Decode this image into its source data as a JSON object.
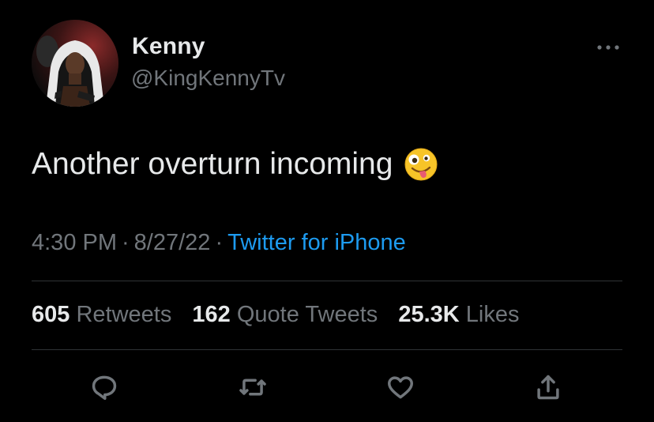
{
  "author": {
    "display_name": "Kenny",
    "handle": "@KingKennyTv"
  },
  "tweet": {
    "text": "Another overturn incoming",
    "emoji_icon": "zany-face-icon"
  },
  "meta": {
    "time": "4:30 PM",
    "separator": "·",
    "date": "8/27/22",
    "source": "Twitter for iPhone"
  },
  "stats": {
    "retweets_count": "605",
    "retweets_label": "Retweets",
    "quotes_count": "162",
    "quotes_label": "Quote Tweets",
    "likes_count": "25.3K",
    "likes_label": "Likes"
  },
  "actions": [
    {
      "icon": "reply-icon"
    },
    {
      "icon": "retweet-icon"
    },
    {
      "icon": "like-icon"
    },
    {
      "icon": "share-icon"
    }
  ],
  "colors": {
    "background": "#000000",
    "primary_text": "#e7e9ea",
    "secondary_text": "#71767b",
    "link": "#1d9bf0",
    "divider": "#2f3336"
  }
}
